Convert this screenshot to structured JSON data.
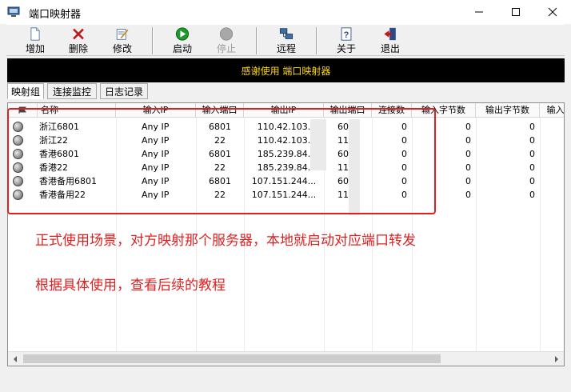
{
  "window": {
    "title": "端口映射器"
  },
  "toolbar": {
    "add": "增加",
    "delete": "删除",
    "edit": "修改",
    "start": "启动",
    "stop": "停止",
    "remote": "远程",
    "about": "关于",
    "exit": "退出"
  },
  "banner": {
    "text": "感谢使用 端口映射器"
  },
  "tabs": [
    "映射组",
    "连接监控",
    "日志记录"
  ],
  "columns": [
    "名称",
    "输入IP",
    "输入端口",
    "输出IP",
    "输出端口",
    "连接数",
    "输入字节数",
    "输出字节数",
    "输入"
  ],
  "rows": [
    {
      "name": "浙江6801",
      "in_ip": "Any IP",
      "in_port": "6801",
      "out_ip": "110.42.103.",
      "out_port": "60",
      "conns": "0",
      "in_bytes": "0",
      "out_bytes": "0"
    },
    {
      "name": "浙江22",
      "in_ip": "Any IP",
      "in_port": "22",
      "out_ip": "110.42.103.",
      "out_port": "11",
      "conns": "0",
      "in_bytes": "0",
      "out_bytes": "0"
    },
    {
      "name": "香港6801",
      "in_ip": "Any IP",
      "in_port": "6801",
      "out_ip": "185.239.84.",
      "out_port": "60",
      "conns": "0",
      "in_bytes": "0",
      "out_bytes": "0"
    },
    {
      "name": "香港22",
      "in_ip": "Any IP",
      "in_port": "22",
      "out_ip": "185.239.84.",
      "out_port": "11",
      "conns": "0",
      "in_bytes": "0",
      "out_bytes": "0"
    },
    {
      "name": "香港备用6801",
      "in_ip": "Any IP",
      "in_port": "6801",
      "out_ip": "107.151.244...",
      "out_port": "60",
      "conns": "0",
      "in_bytes": "0",
      "out_bytes": "0"
    },
    {
      "name": "香港备用22",
      "in_ip": "Any IP",
      "in_port": "22",
      "out_ip": "107.151.244...",
      "out_port": "11",
      "conns": "0",
      "in_bytes": "0",
      "out_bytes": "0"
    }
  ],
  "annotations": {
    "line1": "正式使用场景，对方映射那个服务器，本地就启动对应端口转发",
    "line2": "根据具体使用，查看后续的教程"
  },
  "colors": {
    "banner_bg": "#000000",
    "banner_text": "#ffd800",
    "annotation": "#e02020"
  },
  "icons": [
    "app-icon",
    "add-icon",
    "delete-icon",
    "edit-icon",
    "start-icon",
    "stop-icon",
    "remote-icon",
    "about-icon",
    "exit-icon",
    "status-icon"
  ]
}
